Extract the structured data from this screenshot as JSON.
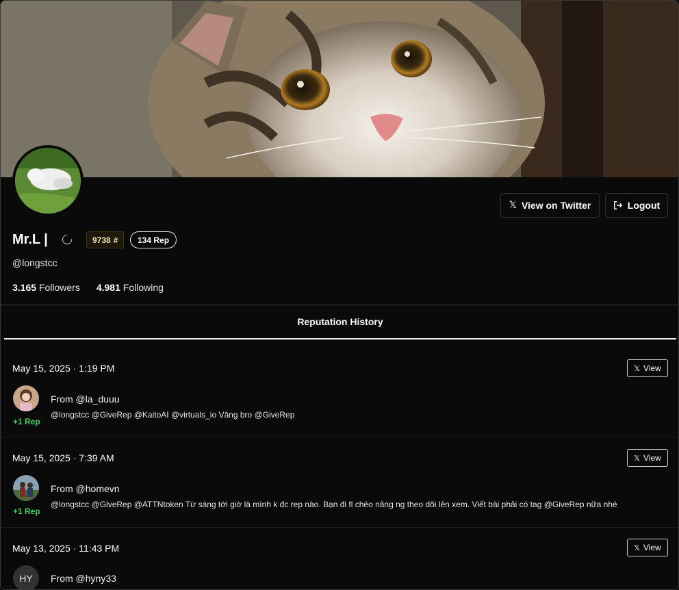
{
  "profile": {
    "name": "Mr.L |",
    "handle": "@longstcc",
    "rank": "9738",
    "rank_symbol": "#",
    "rep_badge": "134 Rep",
    "followers_count": "3.165",
    "followers_label": "Followers",
    "following_count": "4.981",
    "following_label": "Following"
  },
  "actions": {
    "view_twitter_label": "View on Twitter",
    "logout_label": "Logout"
  },
  "tab": {
    "label": "Reputation History"
  },
  "history": [
    {
      "date": "May 15, 2025 · 1:19 PM",
      "view_label": "View",
      "from": "From @la_duuu",
      "text": "@longstcc @GiveRep @KaitoAI @virtuals_io Vâng bro @GiveRep",
      "rep": "+1 Rep"
    },
    {
      "date": "May 15, 2025 · 7:39 AM",
      "view_label": "View",
      "from": "From @homevn",
      "text": "@longstcc @GiveRep @ATTNtoken Từ sáng tới giờ là mình k đc rep nào. Bạn đi fl chéo nâng ng theo dõi lên xem. Viết bài phải có tag @GiveRep nữa nhé",
      "rep": "+1 Rep"
    },
    {
      "date": "May 13, 2025 · 11:43 PM",
      "view_label": "View",
      "from": "From @hyny33",
      "initials": "HY"
    }
  ],
  "icons": {
    "x_logo": "x-logo-icon",
    "logout": "logout-icon",
    "loading": "loading-spinner-icon"
  },
  "colors": {
    "background": "#0a0a0a",
    "rep_green": "#3ed35f",
    "rank_badge_bg": "#1c180b"
  }
}
